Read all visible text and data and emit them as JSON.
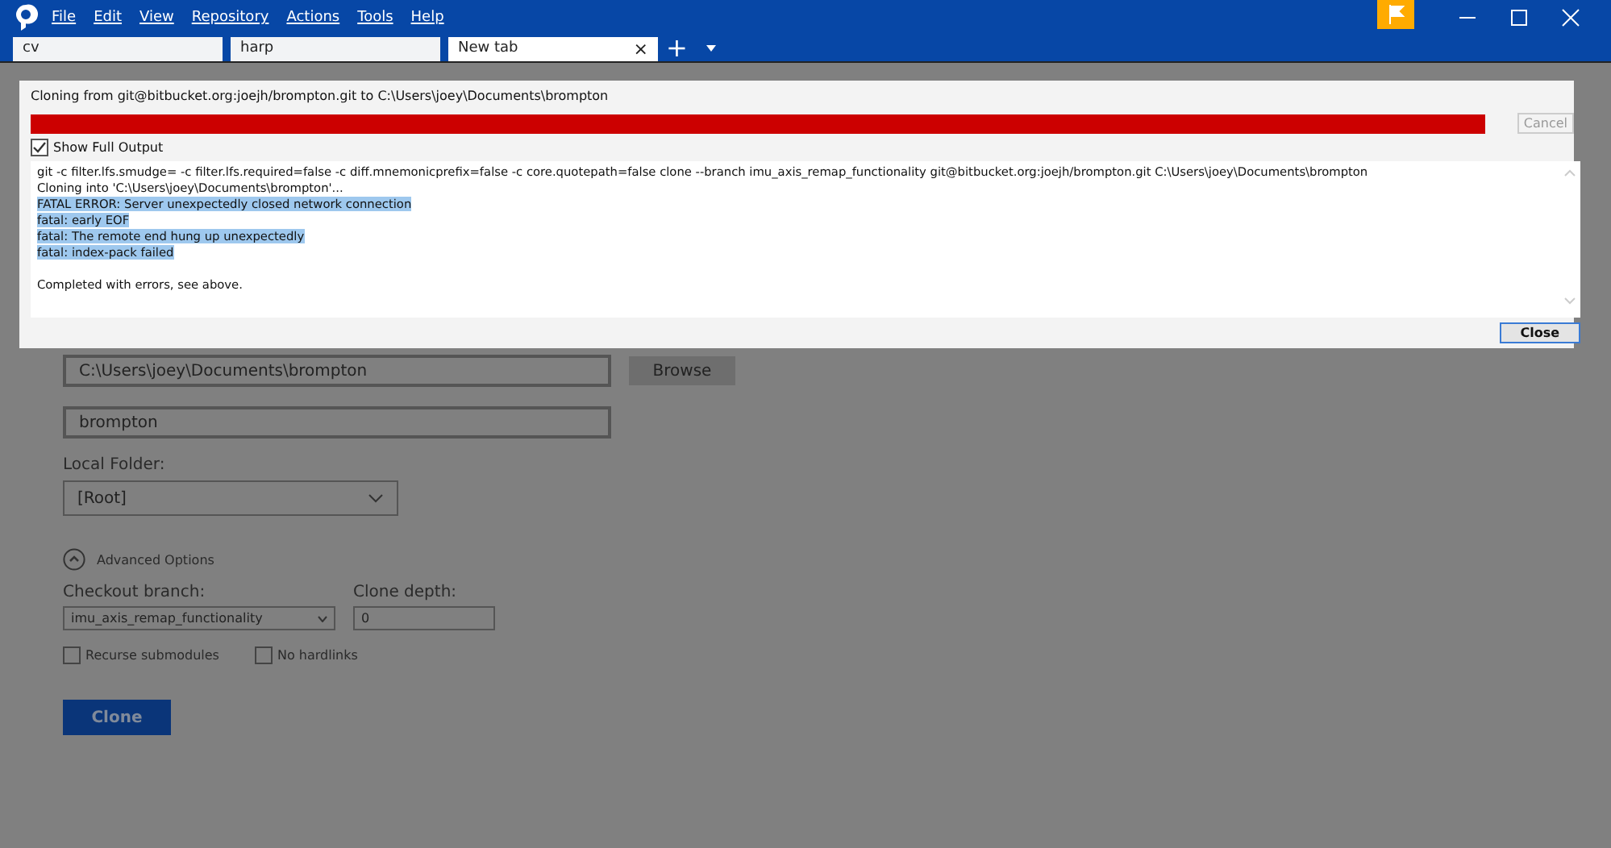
{
  "menu": [
    "File",
    "Edit",
    "View",
    "Repository",
    "Actions",
    "Tools",
    "Help"
  ],
  "tabs": [
    {
      "label": "cv",
      "selected": false
    },
    {
      "label": "harp",
      "selected": false
    },
    {
      "label": "New tab",
      "selected": true
    }
  ],
  "tab_close": "×",
  "add_tab": "+",
  "form": {
    "path": "C:\\Users\\joey\\Documents\\brompton",
    "browse": "Browse",
    "name": "brompton",
    "local_folder_label": "Local Folder:",
    "local_folder": "[Root]",
    "advanced": {
      "label": "Advanced Options",
      "expanded": true
    },
    "branch_label": "Checkout branch:",
    "branch": "imu_axis_remap_functionality",
    "depth_label": "Clone depth:",
    "depth": "0",
    "options": [
      {
        "label": "Recurse submodules",
        "checked": false
      },
      {
        "label": "No hardlinks",
        "checked": false
      }
    ],
    "clone": "Clone"
  },
  "dialog": {
    "title": "Cloning from git@bitbucket.org:joejh/brompton.git to C:\\Users\\joey\\Documents\\brompton",
    "progress": {
      "level": 1
    },
    "cancel": {
      "label": "Cancel",
      "disabled": true
    },
    "show_full_output": {
      "label": "Show Full Output",
      "checked": true
    },
    "output": [
      {
        "text": "git -c filter.lfs.smudge= -c filter.lfs.required=false -c diff.mnemonicprefix=false -c core.quotepath=false clone --branch imu_axis_remap_functionality git@bitbucket.org:joejh/brompton.git C:\\Users\\joey\\Documents\\brompton",
        "selected": false
      },
      {
        "text": "Cloning into 'C:\\Users\\joey\\Documents\\brompton'...",
        "selected": false
      },
      {
        "text": "FATAL ERROR: Server unexpectedly closed network connection",
        "selected": true
      },
      {
        "text": "fatal: early EOF",
        "selected": true
      },
      {
        "text": "fatal: The remote end hung up unexpectedly",
        "selected": true
      },
      {
        "text": "fatal: index-pack failed",
        "selected": true
      },
      {
        "text": "Completed with errors, see above.",
        "selected": false,
        "kind": "summary"
      }
    ],
    "close": "Close"
  }
}
